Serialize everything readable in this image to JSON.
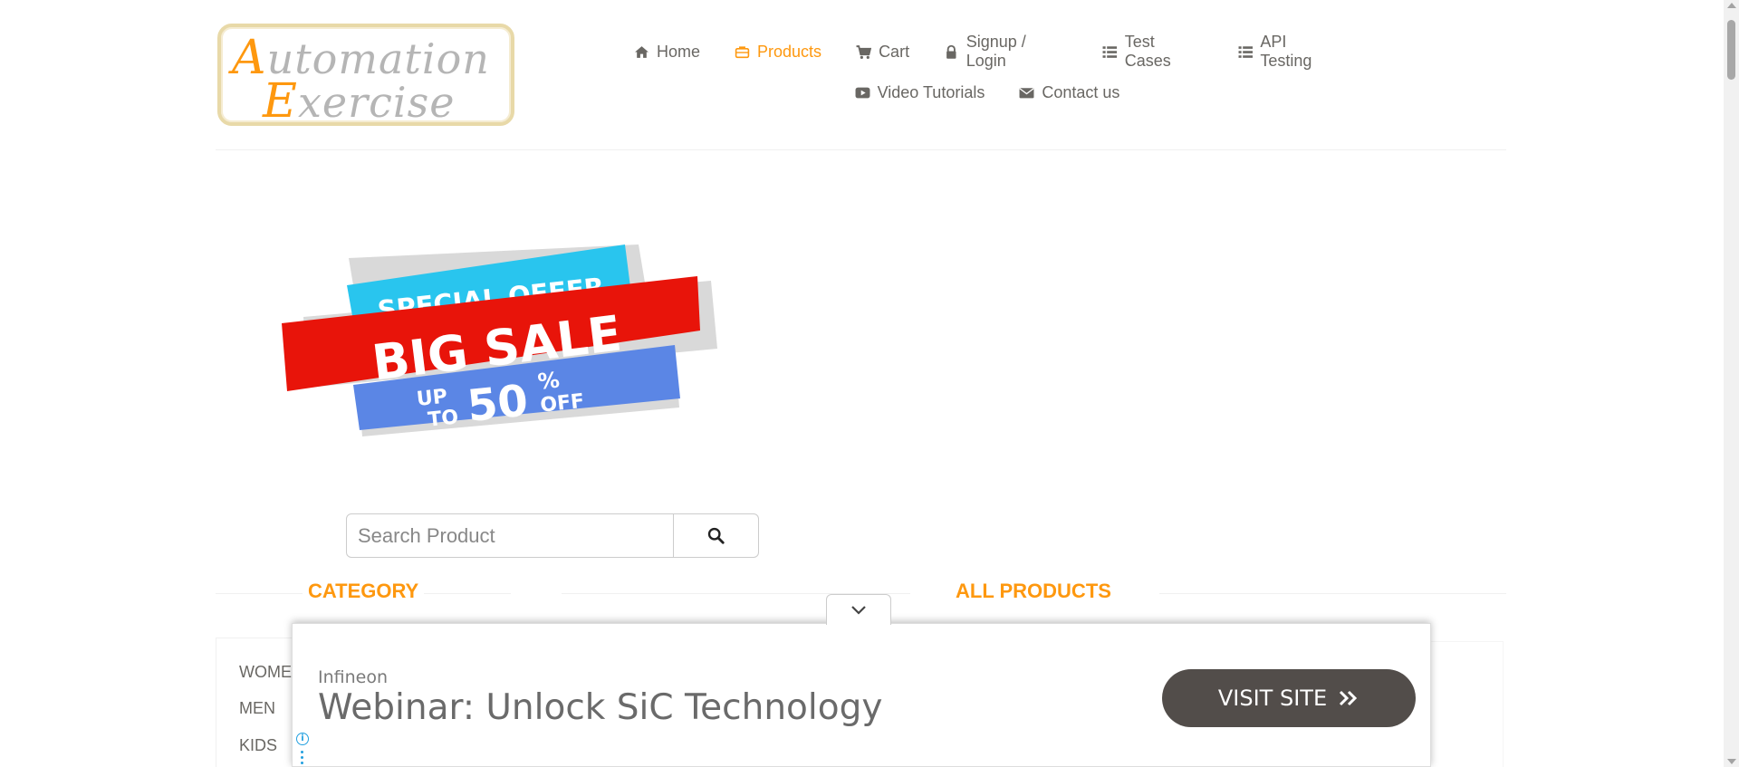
{
  "logo": {
    "line1_cap": "A",
    "line1_rest": "utomation",
    "line2_cap": "E",
    "line2_rest": "xercise"
  },
  "nav": {
    "row1": [
      {
        "label": "Home",
        "icon": "home-icon"
      },
      {
        "label": "Products",
        "icon": "briefcase-icon",
        "active": true
      },
      {
        "label": "Cart",
        "icon": "cart-icon"
      },
      {
        "label": "Signup / Login",
        "icon": "lock-icon"
      },
      {
        "label": "Test Cases",
        "icon": "list-icon"
      },
      {
        "label": "API Testing",
        "icon": "list-icon"
      }
    ],
    "row2": [
      {
        "label": "Video Tutorials",
        "icon": "youtube-play-icon"
      },
      {
        "label": "Contact us",
        "icon": "envelope-icon"
      }
    ]
  },
  "banner": {
    "line1": "SPECIAL OFFER",
    "line2": "BIG SALE",
    "up": "UP",
    "to": "TO",
    "number": "50",
    "percent": "%",
    "off": "OFF"
  },
  "search": {
    "placeholder": "Search Product",
    "icon": "search-icon"
  },
  "sections": {
    "category": "CATEGORY",
    "all_products": "ALL PRODUCTS"
  },
  "categories": [
    "WOMEN",
    "MEN",
    "KIDS"
  ],
  "ad": {
    "brand": "Infineon",
    "headline": "Webinar: Unlock SiC Technology",
    "cta": "VISIT SITE",
    "info_icon": "info-icon",
    "menu_icon": "vertical-dots-icon",
    "toggle_icon": "chevron-down-icon"
  },
  "colors": {
    "accent": "#fe980f",
    "text": "#696763",
    "banner_cyan": "#29c5ee",
    "banner_red": "#e8140a",
    "banner_blue": "#5b86e5",
    "cta_bg": "#524d4a"
  }
}
